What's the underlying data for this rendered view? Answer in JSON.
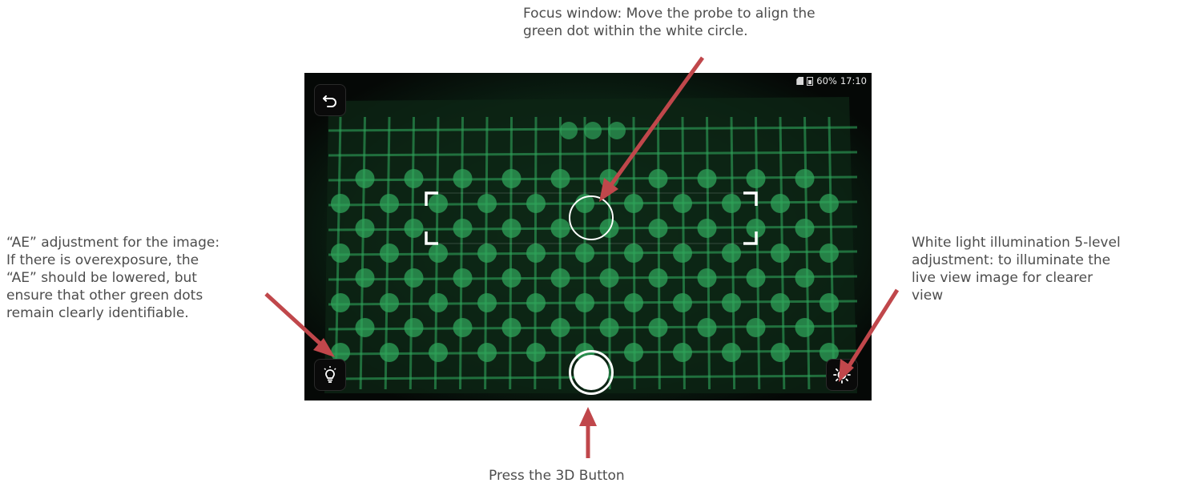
{
  "annotations": {
    "focus_window": "Focus window: Move the probe to align the\ngreen dot within the white circle.",
    "ae_adjustment": "“AE” adjustment for the image:\nIf there is overexposure, the\n“AE” should be lowered, but\nensure that other green dots\nremain clearly identifiable.",
    "white_light": "White light illumination 5-level\nadjustment: to illuminate the\nlive view image for clearer\nview",
    "press_3d": "Press the 3D Button"
  },
  "status_bar": {
    "battery": "60%",
    "time": "17:10"
  },
  "icons": {
    "back": "back-arrow-icon",
    "ae": "lightbulb-icon",
    "light": "sun-icon",
    "shutter": "shutter-icon"
  },
  "colors": {
    "arrow": "#c0474b",
    "scan_green": "#2fa35a",
    "frame_white": "#ffffff"
  }
}
